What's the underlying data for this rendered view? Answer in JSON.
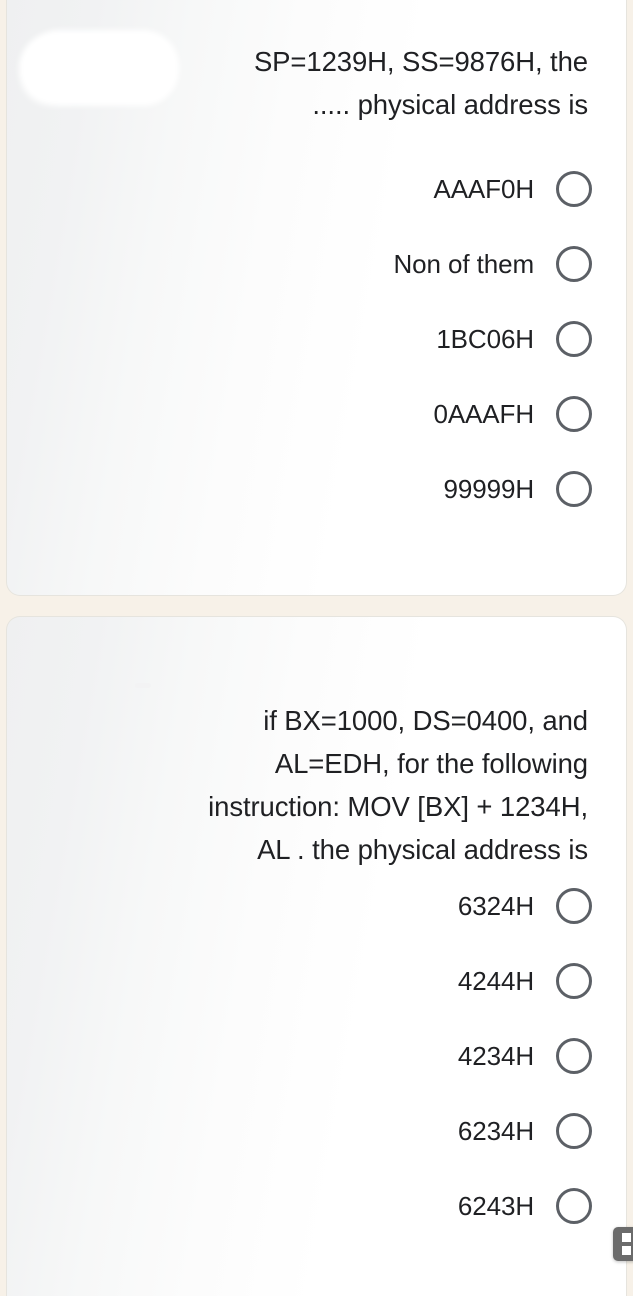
{
  "theme": {
    "page_background": "#f7f1e8",
    "card_background": "#ffffff",
    "card_gradient_tint": "#eff0f1",
    "text_color": "#1f2023",
    "radio_border_color": "#5c6066",
    "badge_color": "#6b6b6b"
  },
  "cards": [
    {
      "id": "question-card-1",
      "question": "SP=1239H, SS=9876H, the\n..... physical address is",
      "options": [
        {
          "label": "AAAF0H",
          "selected": false
        },
        {
          "label": "Non of them",
          "selected": false
        },
        {
          "label": "1BC06H",
          "selected": false
        },
        {
          "label": "0AAAFH",
          "selected": false
        },
        {
          "label": "99999H",
          "selected": false
        }
      ]
    },
    {
      "id": "question-card-2",
      "question": "if BX=1000, DS=0400, and\nAL=EDH, for the following\ninstruction: MOV [BX] + 1234H,\nAL . the physical address is",
      "options": [
        {
          "label": "6324H",
          "selected": false
        },
        {
          "label": "4244H",
          "selected": false
        },
        {
          "label": "4234H",
          "selected": false
        },
        {
          "label": "6234H",
          "selected": false
        },
        {
          "label": "6243H",
          "selected": false
        }
      ]
    }
  ],
  "floating_badge": {
    "icon": "split-screen-icon"
  }
}
